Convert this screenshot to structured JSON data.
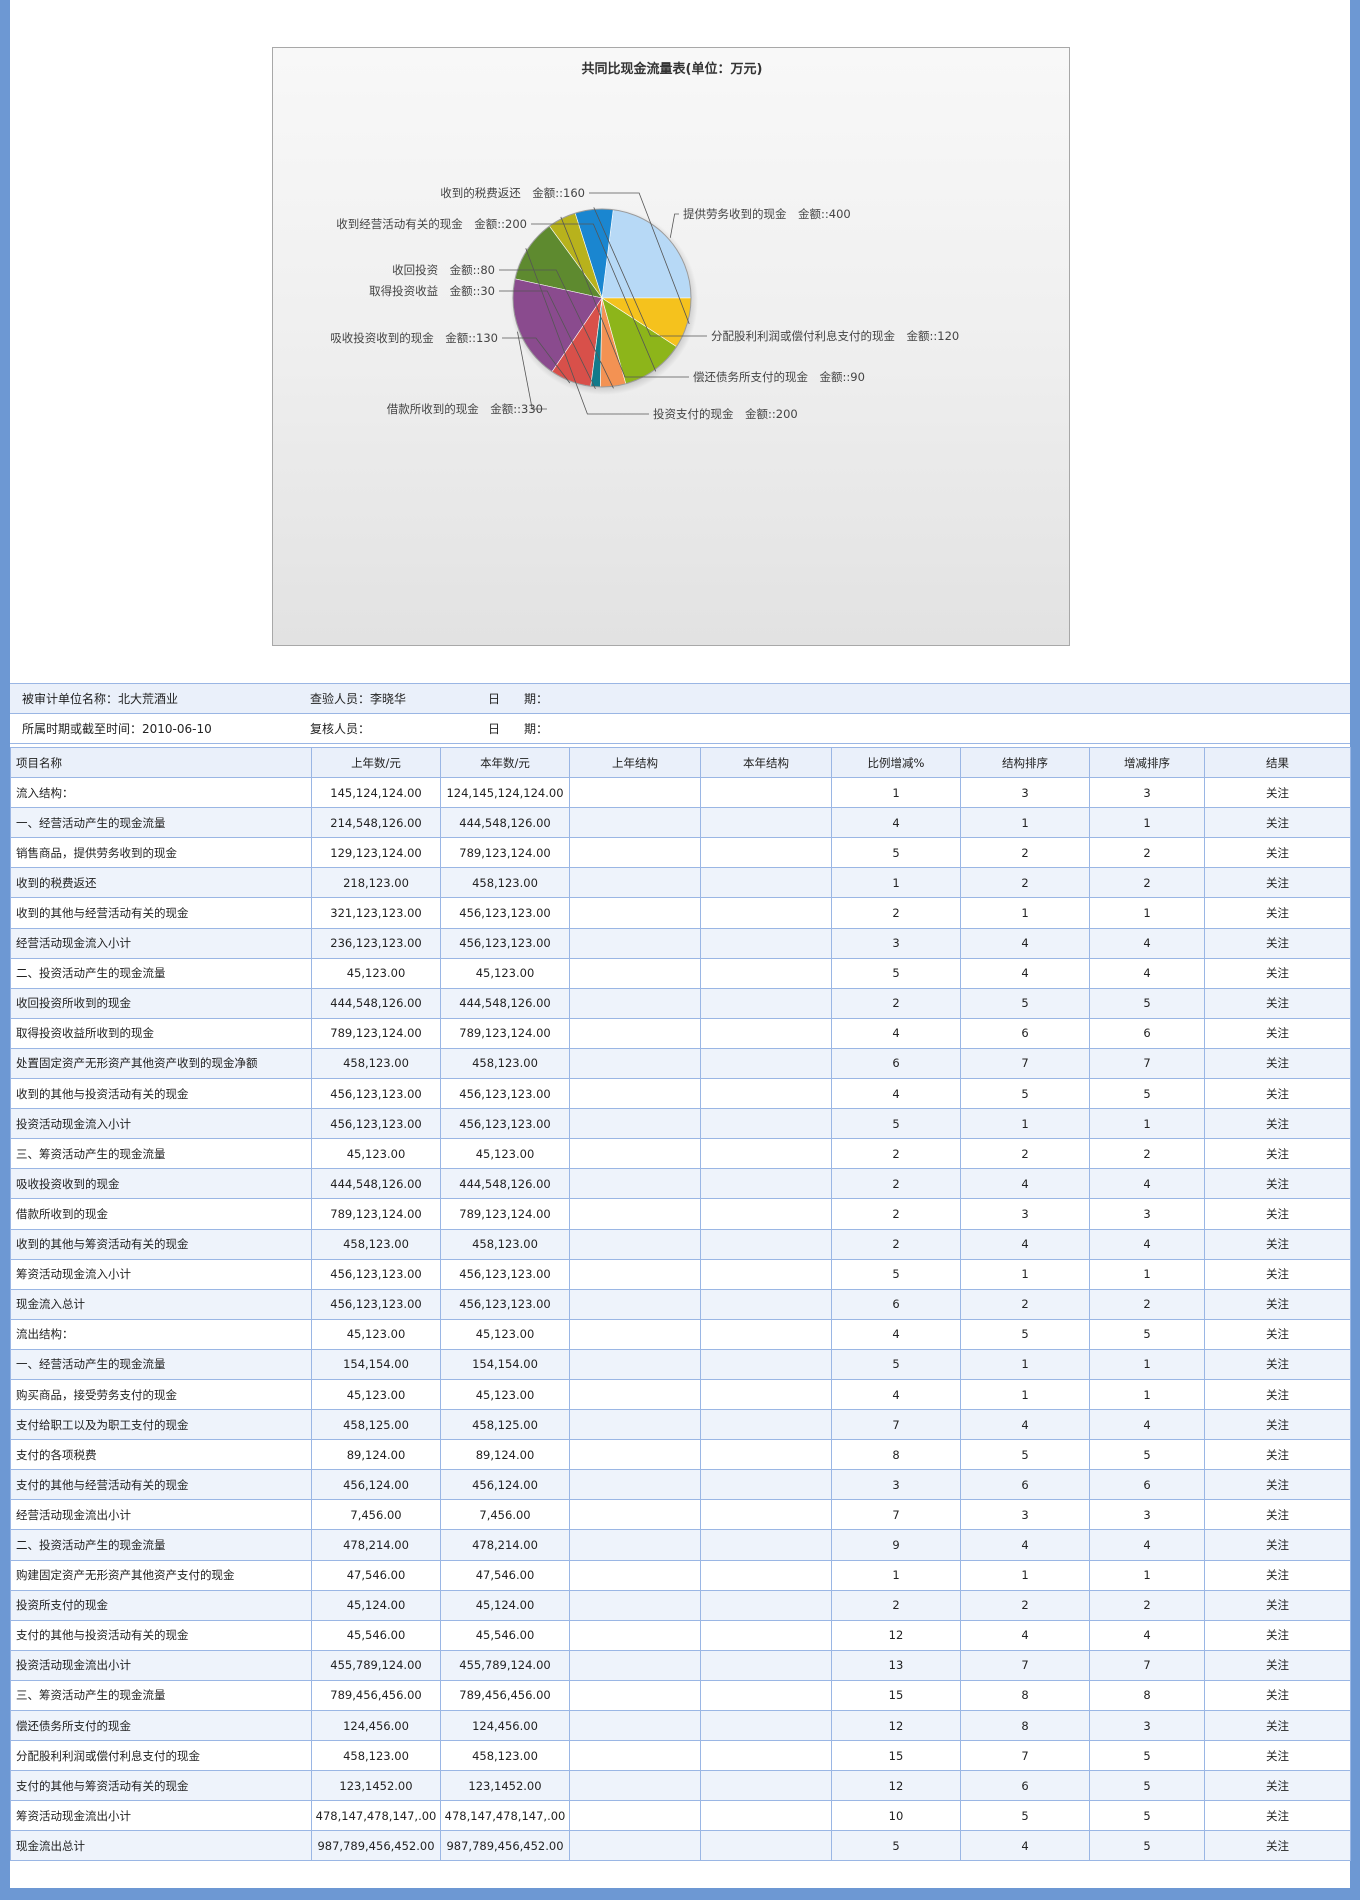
{
  "chart_data": {
    "type": "pie",
    "title": "共同比现金流量表(单位：万元)",
    "value_prefix": "金额::",
    "slices": [
      {
        "label": "提供劳务收到的现金",
        "value": 400,
        "color": "#b7d9f6"
      },
      {
        "label": "分配股利利润或偿付利息支付的现金",
        "value": 120,
        "color": "#1a86d0"
      },
      {
        "label": "偿还债务所支付的现金",
        "value": 90,
        "color": "#b8b21c"
      },
      {
        "label": "投资支付的现金",
        "value": 200,
        "color": "#5e8a2f"
      },
      {
        "label": "借款所收到的现金",
        "value": 330,
        "color": "#8a4b8e"
      },
      {
        "label": "吸收投资收到的现金",
        "value": 130,
        "color": "#d8504a"
      },
      {
        "label": "取得投资收益",
        "value": 30,
        "color": "#137a8a"
      },
      {
        "label": "收回投资",
        "value": 80,
        "color": "#f39253"
      },
      {
        "label": "收到经营活动有关的现金",
        "value": 200,
        "color": "#8db51a"
      },
      {
        "label": "收到的税费返还",
        "value": 160,
        "color": "#f5c21d"
      }
    ]
  },
  "info": {
    "unit_label": "被审计单位名称：北大荒酒业",
    "checker_label": "查验人员：李晓华",
    "date_label_1": "日　　期：",
    "period_label": "所属时期或截至时间：2010-06-10",
    "reviewer_label": "复核人员：",
    "date_label_2": "日　　期："
  },
  "table": {
    "headers": [
      "项目名称",
      "上年数/元",
      "本年数/元",
      "上年结构",
      "本年结构",
      "比例增减%",
      "结构排序",
      "增减排序",
      "结果"
    ],
    "rows": [
      [
        "流入结构：",
        "145,124,124.00",
        "124,145,124,124.00",
        "",
        "",
        "1",
        "3",
        "3",
        "关注"
      ],
      [
        "一、经营活动产生的现金流量",
        "214,548,126.00",
        "444,548,126.00",
        "",
        "",
        "4",
        "1",
        "1",
        "关注"
      ],
      [
        "销售商品，提供劳务收到的现金",
        "129,123,124.00",
        "789,123,124.00",
        "",
        "",
        "5",
        "2",
        "2",
        "关注"
      ],
      [
        "收到的税费返还",
        "218,123.00",
        "458,123.00",
        "",
        "",
        "1",
        "2",
        "2",
        "关注"
      ],
      [
        "收到的其他与经营活动有关的现金",
        "321,123,123.00",
        "456,123,123.00",
        "",
        "",
        "2",
        "1",
        "1",
        "关注"
      ],
      [
        "经营活动现金流入小计",
        "236,123,123.00",
        "456,123,123.00",
        "",
        "",
        "3",
        "4",
        "4",
        "关注"
      ],
      [
        "二、投资活动产生的现金流量",
        "45,123.00",
        "45,123.00",
        "",
        "",
        "5",
        "4",
        "4",
        "关注"
      ],
      [
        "收回投资所收到的现金",
        "444,548,126.00",
        "444,548,126.00",
        "",
        "",
        "2",
        "5",
        "5",
        "关注"
      ],
      [
        "取得投资收益所收到的现金",
        "789,123,124.00",
        "789,123,124.00",
        "",
        "",
        "4",
        "6",
        "6",
        "关注"
      ],
      [
        "处置固定资产无形资产其他资产收到的现金净额",
        "458,123.00",
        "458,123.00",
        "",
        "",
        "6",
        "7",
        "7",
        "关注"
      ],
      [
        "收到的其他与投资活动有关的现金",
        "456,123,123.00",
        "456,123,123.00",
        "",
        "",
        "4",
        "5",
        "5",
        "关注"
      ],
      [
        "投资活动现金流入小计",
        "456,123,123.00",
        "456,123,123.00",
        "",
        "",
        "5",
        "1",
        "1",
        "关注"
      ],
      [
        "三、筹资活动产生的现金流量",
        "45,123.00",
        "45,123.00",
        "",
        "",
        "2",
        "2",
        "2",
        "关注"
      ],
      [
        "吸收投资收到的现金",
        "444,548,126.00",
        "444,548,126.00",
        "",
        "",
        "2",
        "4",
        "4",
        "关注"
      ],
      [
        "借款所收到的现金",
        "789,123,124.00",
        "789,123,124.00",
        "",
        "",
        "2",
        "3",
        "3",
        "关注"
      ],
      [
        "收到的其他与筹资活动有关的现金",
        "458,123.00",
        "458,123.00",
        "",
        "",
        "2",
        "4",
        "4",
        "关注"
      ],
      [
        "筹资活动现金流入小计",
        "456,123,123.00",
        "456,123,123.00",
        "",
        "",
        "5",
        "1",
        "1",
        "关注"
      ],
      [
        "现金流入总计",
        "456,123,123.00",
        "456,123,123.00",
        "",
        "",
        "6",
        "2",
        "2",
        "关注"
      ],
      [
        "流出结构：",
        "45,123.00",
        "45,123.00",
        "",
        "",
        "4",
        "5",
        "5",
        "关注"
      ],
      [
        "一、经营活动产生的现金流量",
        "154,154.00",
        "154,154.00",
        "",
        "",
        "5",
        "1",
        "1",
        "关注"
      ],
      [
        "购买商品，接受劳务支付的现金",
        "45,123.00",
        "45,123.00",
        "",
        "",
        "4",
        "1",
        "1",
        "关注"
      ],
      [
        "支付给职工以及为职工支付的现金",
        "458,125.00",
        "458,125.00",
        "",
        "",
        "7",
        "4",
        "4",
        "关注"
      ],
      [
        "支付的各项税费",
        "89,124.00",
        "89,124.00",
        "",
        "",
        "8",
        "5",
        "5",
        "关注"
      ],
      [
        "支付的其他与经营活动有关的现金",
        "456,124.00",
        "456,124.00",
        "",
        "",
        "3",
        "6",
        "6",
        "关注"
      ],
      [
        "经营活动现金流出小计",
        "7,456.00",
        "7,456.00",
        "",
        "",
        "7",
        "3",
        "3",
        "关注"
      ],
      [
        "二、投资活动产生的现金流量",
        "478,214.00",
        "478,214.00",
        "",
        "",
        "9",
        "4",
        "4",
        "关注"
      ],
      [
        "购建固定资产无形资产其他资产支付的现金",
        "47,546.00",
        "47,546.00",
        "",
        "",
        "1",
        "1",
        "1",
        "关注"
      ],
      [
        "投资所支付的现金",
        "45,124.00",
        "45,124.00",
        "",
        "",
        "2",
        "2",
        "2",
        "关注"
      ],
      [
        "支付的其他与投资活动有关的现金",
        "45,546.00",
        "45,546.00",
        "",
        "",
        "12",
        "4",
        "4",
        "关注"
      ],
      [
        "投资活动现金流出小计",
        "455,789,124.00",
        "455,789,124.00",
        "",
        "",
        "13",
        "7",
        "7",
        "关注"
      ],
      [
        "三、筹资活动产生的现金流量",
        "789,456,456.00",
        "789,456,456.00",
        "",
        "",
        "15",
        "8",
        "8",
        "关注"
      ],
      [
        "偿还债务所支付的现金",
        "124,456.00",
        "124,456.00",
        "",
        "",
        "12",
        "8",
        "3",
        "关注"
      ],
      [
        "分配股利利润或偿付利息支付的现金",
        "458,123.00",
        "458,123.00",
        "",
        "",
        "15",
        "7",
        "5",
        "关注"
      ],
      [
        "支付的其他与筹资活动有关的现金",
        "123,1452.00",
        "123,1452.00",
        "",
        "",
        "12",
        "6",
        "5",
        "关注"
      ],
      [
        "筹资活动现金流出小计",
        "478,147,478,147,.00",
        "478,147,478,147,.00",
        "",
        "",
        "10",
        "5",
        "5",
        "关注"
      ],
      [
        "现金流出总计",
        "987,789,456,452.00",
        "987,789,456,452.00",
        "",
        "",
        "5",
        "4",
        "5",
        "关注"
      ]
    ]
  }
}
